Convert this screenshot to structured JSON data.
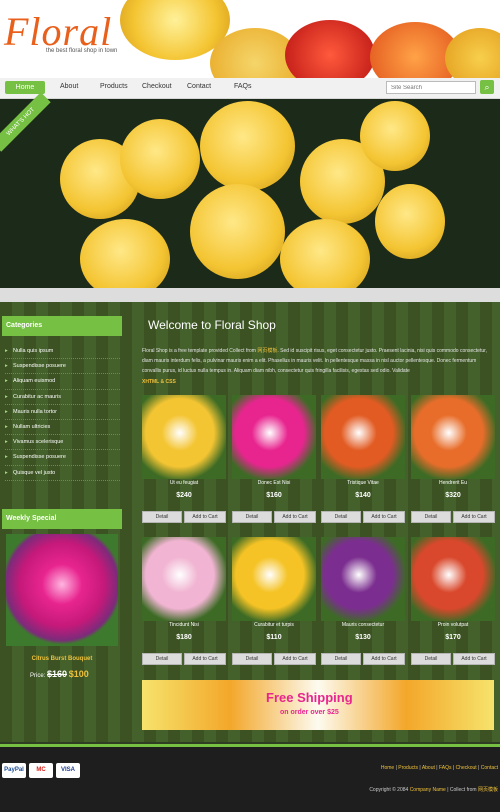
{
  "header": {
    "logo": "Floral",
    "tagline": "the best floral shop in town"
  },
  "nav": {
    "items": [
      "Home",
      "About",
      "Products",
      "Checkout",
      "Contact",
      "FAQs"
    ],
    "search_placeholder": "Site Search",
    "search_icon": "search-icon"
  },
  "hero": {
    "badge": "WHAT'S HOT"
  },
  "sidebar": {
    "categories_title": "Categories",
    "categories": [
      "Nulla quis ipsum",
      "Suspendisse posuere",
      "Aliquam euismod",
      "Curabitur ac mauris",
      "Mauris nulla tortor",
      "Nullam ultricies",
      "Vivamus scelerisque",
      "Suspendisse posuere",
      "Quisque vel justo"
    ],
    "weekly_title": "Weekly Special",
    "weekly_name": "Citrus Burst Bouquet",
    "weekly_price_label": "Price:",
    "weekly_old_price": "$160",
    "weekly_new_price": "$100"
  },
  "main": {
    "welcome": "Welcome to Floral Shop",
    "intro_1": "Floral Shop is a free template provided Collect from",
    "intro_link": "网页模板",
    "intro_2": ". Sed id suscipit risus, eget consectetur justo. Praesent lacinia, nisi quis commodo consectetur, diam mauris interdum felis, a pulvinar mauris enim a elit. Phasellus in mauris velit. In pellentesque massa in nisl auctor pellentesque. Donec fermentum convallis purus, id luctus nulla tempus in. Aliquam diam nibh, consectetur quis fringilla facilisis, egestas sed odio. Validate",
    "validate": "XHTML & CSS",
    "detail_label": "Detail",
    "cart_label": "Add to Cart"
  },
  "products": [
    {
      "name": "Ut eu feugiat",
      "price": "$240",
      "color": "#f4c533"
    },
    {
      "name": "Donec Est Nisi",
      "price": "$160",
      "color": "#e8258f"
    },
    {
      "name": "Tristique Vitae",
      "price": "$140",
      "color": "#e25b23"
    },
    {
      "name": "Hendrerit Eu",
      "price": "$320",
      "color": "#e86d2a"
    },
    {
      "name": "Tincidunt Nisi",
      "price": "$180",
      "color": "#f1b4d2"
    },
    {
      "name": "Curabitur et turpis",
      "price": "$110",
      "color": "#f5c325"
    },
    {
      "name": "Mauris consectetur",
      "price": "$130",
      "color": "#7b2e8f"
    },
    {
      "name": "Proin volutpat",
      "price": "$170",
      "color": "#d9482c"
    }
  ],
  "banner": {
    "title": "Free Shipping",
    "subtitle": "on order over $25"
  },
  "footer": {
    "payments": [
      "PayPal",
      "MC",
      "VISA"
    ],
    "links": [
      "Home",
      "Products",
      "About",
      "FAQs",
      "Checkout",
      "Contact"
    ],
    "copyright": "Copyright © 2084",
    "company": "Company Name",
    "collect": "| Collect from",
    "collect_link": "网页模板"
  }
}
